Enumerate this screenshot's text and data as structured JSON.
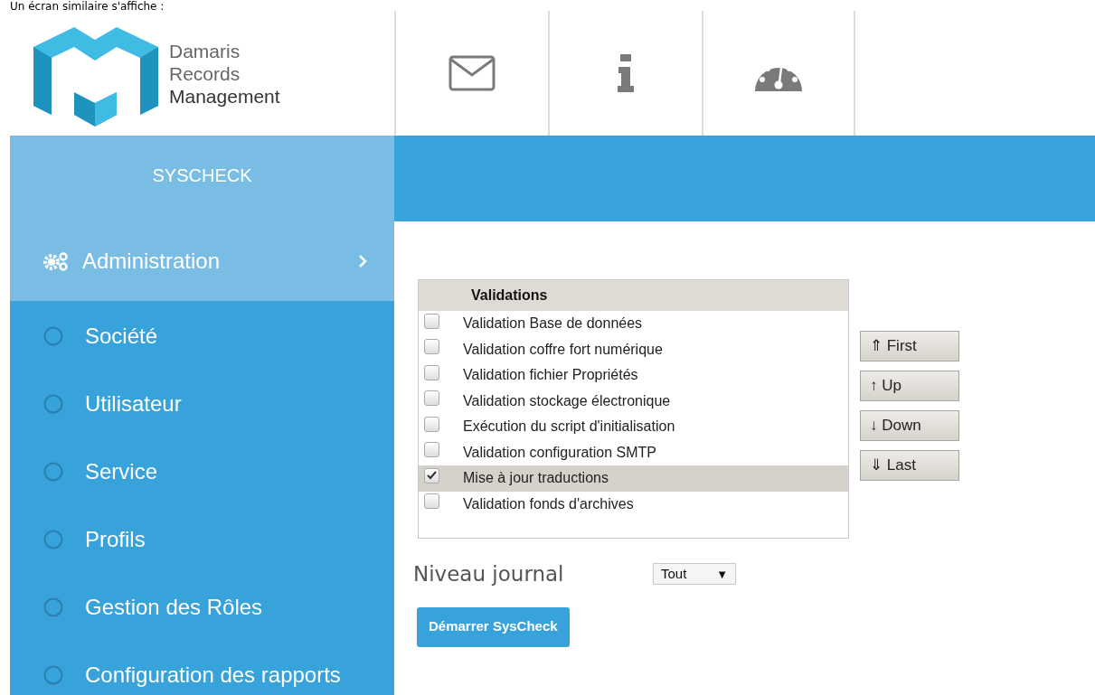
{
  "caption": "Un écran similaire s'affiche :",
  "logo": {
    "lines": [
      "Damaris",
      "Records",
      "Management"
    ]
  },
  "toolbar": [
    {
      "kind": "mail"
    },
    {
      "kind": "info"
    },
    {
      "kind": "dashboard"
    }
  ],
  "sidebar": {
    "title": "SYSCHECK",
    "section": {
      "label": "Administration",
      "expanded": true
    },
    "items": [
      {
        "label": "Société",
        "selected": false
      },
      {
        "label": "Utilisateur",
        "selected": false
      },
      {
        "label": "Service",
        "selected": false
      },
      {
        "label": "Profils",
        "selected": false
      },
      {
        "label": "Gestion des Rôles",
        "selected": false
      },
      {
        "label": "Configuration des rapports",
        "selected": false
      }
    ]
  },
  "validations": {
    "header": "Validations",
    "rows": [
      {
        "label": "Validation Base de données",
        "checked": false,
        "selected": false
      },
      {
        "label": "Validation coffre fort numérique",
        "checked": false,
        "selected": false
      },
      {
        "label": "Validation fichier Propriétés",
        "checked": false,
        "selected": false
      },
      {
        "label": "Validation stockage électronique",
        "checked": false,
        "selected": false
      },
      {
        "label": "Exécution du script d'initialisation",
        "checked": false,
        "selected": false
      },
      {
        "label": "Validation configuration SMTP",
        "checked": false,
        "selected": false
      },
      {
        "label": "Mise à jour traductions",
        "checked": true,
        "selected": true
      },
      {
        "label": "Validation fonds d'archives",
        "checked": false,
        "selected": false
      }
    ]
  },
  "order_buttons": [
    {
      "label": "⇑ First"
    },
    {
      "label": "↑ Up"
    },
    {
      "label": "↓ Down"
    },
    {
      "label": "⇓ Last"
    }
  ],
  "log_level": {
    "label": "Niveau journal",
    "value": "Tout",
    "arrow": "▼"
  },
  "start_button": "Démarrer SysCheck"
}
